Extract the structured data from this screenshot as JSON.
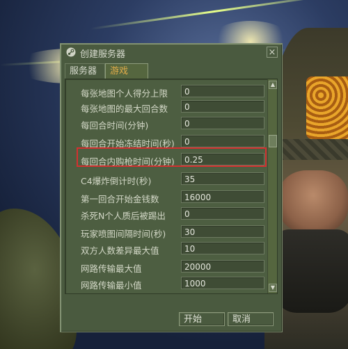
{
  "window": {
    "title": "创建服务器",
    "close_glyph": "×",
    "icon": "steam-icon"
  },
  "tabs": [
    {
      "label": "服务器",
      "active": false
    },
    {
      "label": "游戏",
      "active": true
    }
  ],
  "settings": [
    {
      "label": "每张地图个人得分上限",
      "value": "0"
    },
    {
      "label": "每张地图的最大回合数",
      "value": "0"
    },
    {
      "label": "每回合时间(分钟)",
      "value": "0"
    },
    {
      "label": "每回合开始冻结时间(秒)",
      "value": "0"
    },
    {
      "label": "每回合内购枪时间(分钟)",
      "value": "0.25"
    },
    {
      "label": "C4爆炸倒计时(秒)",
      "value": "35"
    },
    {
      "label": "第一回合开始金钱数",
      "value": "16000"
    },
    {
      "label": "杀死N个人质后被踢出",
      "value": "0"
    },
    {
      "label": "玩家喷图间隔时间(秒)",
      "value": "30"
    },
    {
      "label": "双方人数差异最大值",
      "value": "10"
    },
    {
      "label": "网路传输最大值",
      "value": "20000"
    },
    {
      "label": "网路传输最小值",
      "value": "1000"
    }
  ],
  "highlighted_setting": "每回合内购枪时间(分钟)",
  "buttons": {
    "start": "开始",
    "cancel": "取消"
  },
  "colors": {
    "dialog_bg": "#4a5a3f",
    "active_tab_text": "#e3ad4a",
    "highlight_border": "#d43030"
  }
}
